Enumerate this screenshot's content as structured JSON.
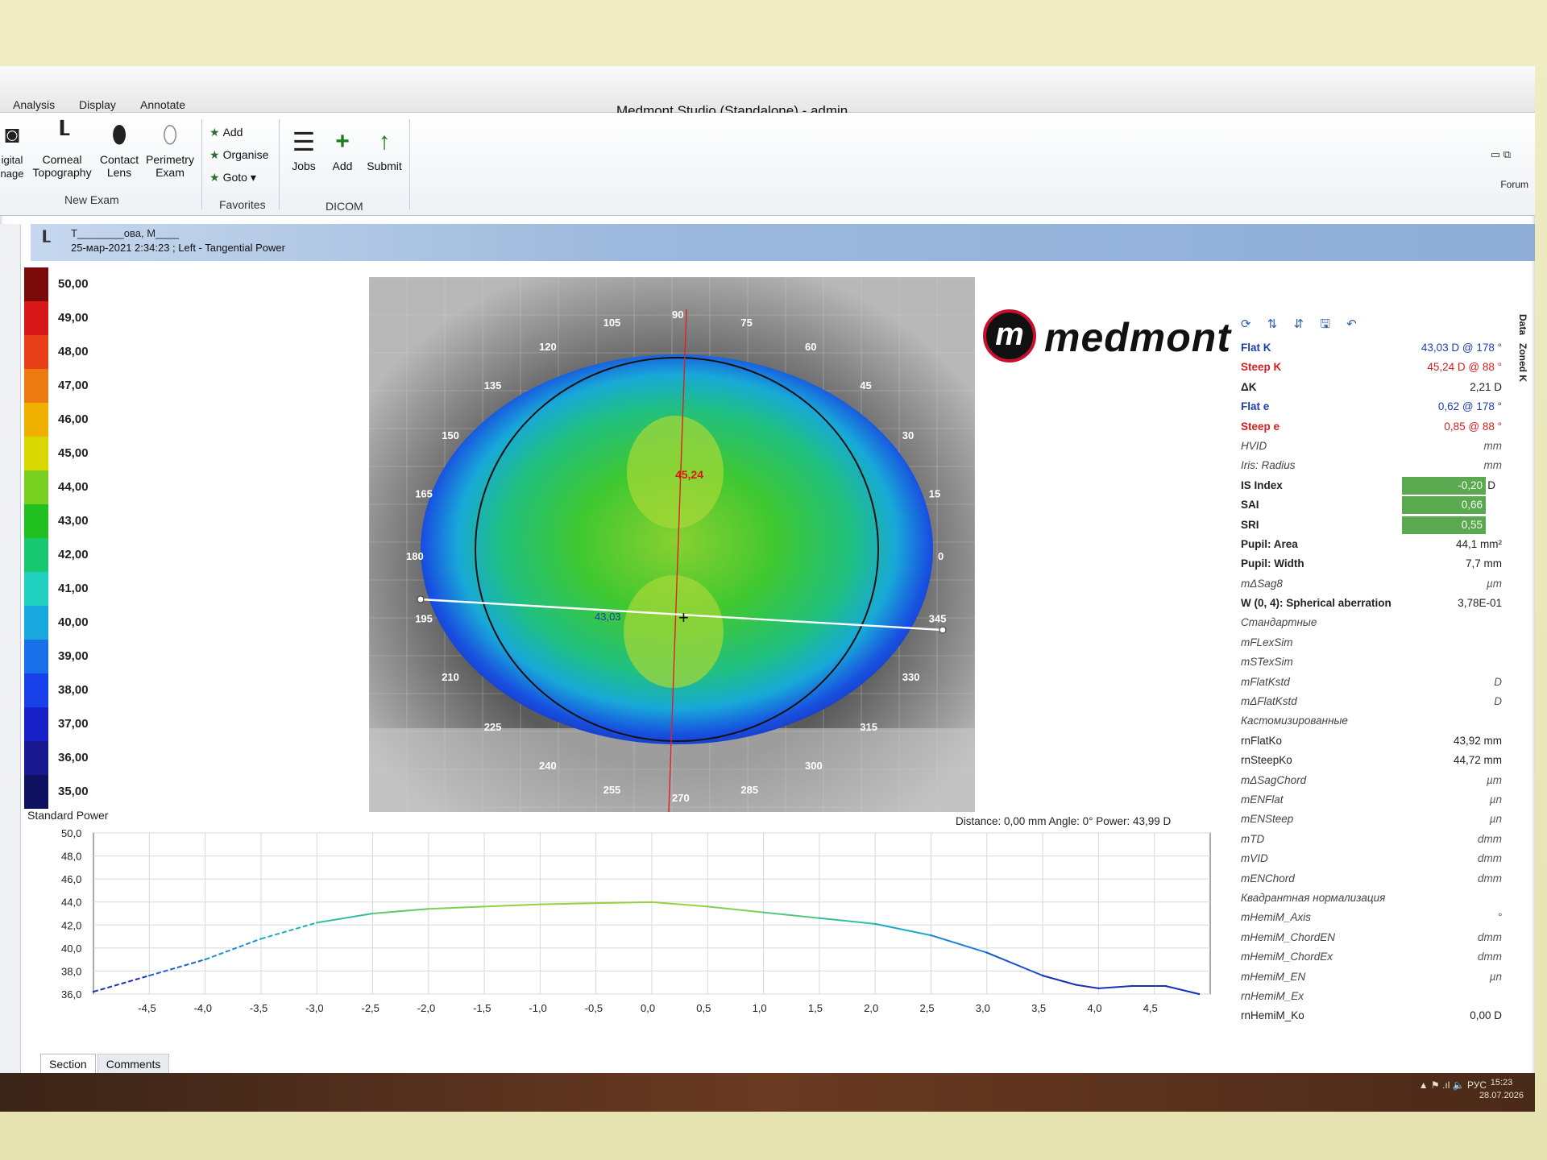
{
  "app": {
    "title": "Medmont Studio (Standalone) - admin",
    "forum": "Forum",
    "window_controls": "▭  ⧉"
  },
  "menu": [
    "Analysis",
    "Display",
    "Annotate"
  ],
  "ribbon": {
    "digital_image": "igital\nnage",
    "corneal_topography": "Corneal\nTopography",
    "contact_lens": "Contact\nLens",
    "perimetry_exam": "Perimetry\nExam",
    "new_exam": "New Exam",
    "fav_add": "Add",
    "fav_organise": "Organise",
    "fav_goto": "Goto",
    "favorites": "Favorites",
    "jobs": "Jobs",
    "dicom_add": "Add",
    "submit": "Submit",
    "dicom": "DICOM"
  },
  "patient": {
    "name": "T________ова, М____",
    "info": "25-мар-2021 2:34:23 ; Left - Tangential Power"
  },
  "scale": {
    "labels": [
      "50,00",
      "49,00",
      "48,00",
      "47,00",
      "46,00",
      "45,00",
      "44,00",
      "43,00",
      "42,00",
      "41,00",
      "40,00",
      "39,00",
      "38,00",
      "37,00",
      "36,00",
      "35,00"
    ],
    "colors": [
      "#7a0a0a",
      "#d81818",
      "#e84018",
      "#ec7a10",
      "#f0b000",
      "#d8d800",
      "#7ad020",
      "#20c020",
      "#18c870",
      "#20d0c0",
      "#18a8e0",
      "#1870e8",
      "#1840e8",
      "#1820c8",
      "#181890",
      "#101060"
    ]
  },
  "map": {
    "angles": [
      "90",
      "75",
      "60",
      "45",
      "30",
      "15",
      "0",
      "345",
      "330",
      "315",
      "300",
      "285",
      "270",
      "255",
      "240",
      "225",
      "210",
      "195",
      "180",
      "165",
      "150",
      "135",
      "120",
      "105"
    ],
    "steep_value": "45,24",
    "flat_value": "43,03"
  },
  "logo": {
    "mark": "m",
    "text": "medmont"
  },
  "panel": {
    "tools": "⟳ ⇅ ⇵ 🖫 ↶",
    "rows": [
      {
        "label": "Flat K",
        "value": "43,03 D @ 178 °",
        "style": "flat bold"
      },
      {
        "label": "Steep K",
        "value": "45,24 D @  88 °",
        "style": "steep bold"
      },
      {
        "label": "ΔK",
        "value": "2,21 D",
        "style": "bold"
      },
      {
        "label": "Flat e",
        "value": "0,62 @ 178 °",
        "style": "flat bold"
      },
      {
        "label": "Steep e",
        "value": "0,85 @  88 °",
        "style": "steep bold"
      },
      {
        "label": "HVID",
        "value": "mm",
        "style": "ital"
      },
      {
        "label": "Iris: Radius",
        "value": "mm",
        "style": "ital"
      },
      {
        "label": "IS Index",
        "value": "-0,20",
        "unit": "D",
        "style": "bold green"
      },
      {
        "label": "SAI",
        "value": "0,66",
        "style": "bold green"
      },
      {
        "label": "SRI",
        "value": "0,55",
        "style": "bold green"
      },
      {
        "label": "Pupil: Area",
        "value": "44,1 mm²",
        "style": "bold"
      },
      {
        "label": "Pupil: Width",
        "value": "7,7 mm",
        "style": "bold"
      },
      {
        "label": "mΔSag8",
        "value": "µm",
        "style": "ital"
      },
      {
        "label": "W (0, 4): Spherical aberration",
        "value": "3,78E-01",
        "style": "bold"
      },
      {
        "label": "Стандартные",
        "value": "",
        "style": "ital"
      },
      {
        "label": "mFLexSim",
        "value": "",
        "style": "ital"
      },
      {
        "label": "mSTexSim",
        "value": "",
        "style": "ital"
      },
      {
        "label": "mFlatKstd",
        "value": "D",
        "style": "ital"
      },
      {
        "label": "mΔFlatKstd",
        "value": "D",
        "style": "ital"
      },
      {
        "label": "Кастомизированные",
        "value": "",
        "style": "ital"
      },
      {
        "label": "rnFlatKo",
        "value": "43,92 mm",
        "style": ""
      },
      {
        "label": "rnSteepKo",
        "value": "44,72 mm",
        "style": ""
      },
      {
        "label": "mΔSagChord",
        "value": "µm",
        "style": "ital"
      },
      {
        "label": "mENFlat",
        "value": "µn",
        "style": "ital"
      },
      {
        "label": "mENSteep",
        "value": "µn",
        "style": "ital"
      },
      {
        "label": "mTD",
        "value": "dmm",
        "style": "ital"
      },
      {
        "label": "mVID",
        "value": "dmm",
        "style": "ital"
      },
      {
        "label": "mENChord",
        "value": "dmm",
        "style": "ital"
      },
      {
        "label": "Квадрантная нормализация",
        "value": "",
        "style": "ital"
      },
      {
        "label": "mHemiM_Axis",
        "value": "°",
        "style": "ital"
      },
      {
        "label": "mHemiM_ChordEN",
        "value": "dmm",
        "style": "ital"
      },
      {
        "label": "mHemiM_ChordEx",
        "value": "dmm",
        "style": "ital"
      },
      {
        "label": "mHemiM_EN",
        "value": "µn",
        "style": "ital"
      },
      {
        "label": "rnHemiM_Ex",
        "value": "",
        "style": "ital"
      },
      {
        "label": "rnHemiM_Ko",
        "value": "0,00 D",
        "style": ""
      }
    ]
  },
  "side_tabs": [
    "Data",
    "Zoned K"
  ],
  "readout": "Distance: 0,00 mm   Angle: 0°   Power: 43,99 D",
  "chart_data": {
    "type": "line",
    "title": "Standard Power",
    "xlabel": "",
    "ylabel": "",
    "xlim": [
      -5.0,
      5.0
    ],
    "ylim": [
      36.0,
      50.0
    ],
    "x_ticks": [
      "-4,5",
      "-4,0",
      "-3,5",
      "-3,0",
      "-2,5",
      "-2,0",
      "-1,5",
      "-1,0",
      "-0,5",
      "0,0",
      "0,5",
      "1,0",
      "1,5",
      "2,0",
      "2,5",
      "3,0",
      "3,5",
      "4,0",
      "4,5"
    ],
    "y_ticks": [
      "50,0",
      "48,0",
      "46,0",
      "44,0",
      "42,0",
      "40,0",
      "38,0",
      "36,0"
    ],
    "grid": true,
    "series": [
      {
        "x": [
          -5.0,
          -4.5,
          -4.0,
          -3.5,
          -3.0,
          -2.5,
          -2.0,
          -1.5,
          -1.0,
          -0.5,
          0.0,
          0.5,
          1.0,
          1.5,
          2.0,
          2.5,
          3.0,
          3.5,
          3.8,
          4.0,
          4.3,
          4.6,
          4.9
        ],
        "values": [
          36.2,
          37.6,
          39.0,
          40.8,
          42.2,
          43.0,
          43.4,
          43.6,
          43.8,
          43.9,
          43.99,
          43.6,
          43.1,
          42.6,
          42.1,
          41.1,
          39.6,
          37.6,
          36.8,
          36.5,
          36.7,
          36.7,
          36.0
        ]
      }
    ]
  },
  "bottom_tabs": [
    "Section",
    "Comments"
  ],
  "taskbar": {
    "tray": "▲  ⚑  .ıl  🔈  РУС",
    "time": "15:23",
    "date": "28.07.2026"
  }
}
